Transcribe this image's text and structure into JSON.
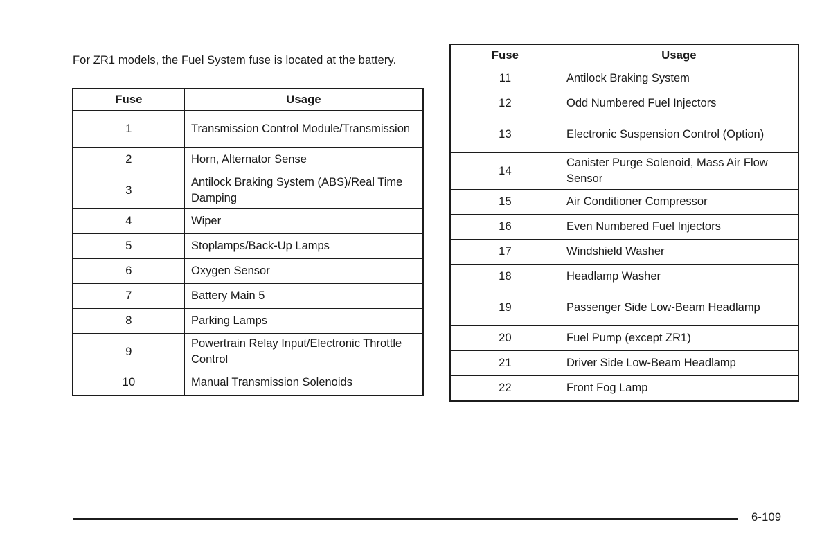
{
  "document": {
    "intro_text": "For ZR1 models, the Fuel System fuse is located at the battery.",
    "page_number": "6-109"
  },
  "tables": {
    "left": {
      "headers": {
        "fuse": "Fuse",
        "usage": "Usage"
      },
      "rows": [
        {
          "fuse": "1",
          "usage": "Transmission Control Module/Transmission",
          "lines": 2
        },
        {
          "fuse": "2",
          "usage": "Horn, Alternator Sense",
          "lines": 1
        },
        {
          "fuse": "3",
          "usage": "Antilock Braking System (ABS)/Real Time Damping",
          "lines": 2
        },
        {
          "fuse": "4",
          "usage": "Wiper",
          "lines": 1
        },
        {
          "fuse": "5",
          "usage": "Stoplamps/Back-Up Lamps",
          "lines": 1
        },
        {
          "fuse": "6",
          "usage": "Oxygen Sensor",
          "lines": 1
        },
        {
          "fuse": "7",
          "usage": "Battery Main 5",
          "lines": 1
        },
        {
          "fuse": "8",
          "usage": "Parking Lamps",
          "lines": 1
        },
        {
          "fuse": "9",
          "usage": "Powertrain Relay Input/Electronic Throttle Control",
          "lines": 2
        },
        {
          "fuse": "10",
          "usage": "Manual Transmission Solenoids",
          "lines": 1
        }
      ]
    },
    "right": {
      "headers": {
        "fuse": "Fuse",
        "usage": "Usage"
      },
      "rows": [
        {
          "fuse": "11",
          "usage": "Antilock Braking System",
          "lines": 1
        },
        {
          "fuse": "12",
          "usage": "Odd Numbered Fuel Injectors",
          "lines": 1
        },
        {
          "fuse": "13",
          "usage": "Electronic Suspension Control (Option)",
          "lines": 2
        },
        {
          "fuse": "14",
          "usage": "Canister Purge Solenoid, Mass Air Flow Sensor",
          "lines": 2
        },
        {
          "fuse": "15",
          "usage": "Air Conditioner Compressor",
          "lines": 1
        },
        {
          "fuse": "16",
          "usage": "Even Numbered Fuel Injectors",
          "lines": 1
        },
        {
          "fuse": "17",
          "usage": "Windshield Washer",
          "lines": 1
        },
        {
          "fuse": "18",
          "usage": "Headlamp Washer",
          "lines": 1
        },
        {
          "fuse": "19",
          "usage": "Passenger Side Low-Beam Headlamp",
          "lines": 2
        },
        {
          "fuse": "20",
          "usage": "Fuel Pump (except ZR1)",
          "lines": 1
        },
        {
          "fuse": "21",
          "usage": "Driver Side Low-Beam Headlamp",
          "lines": 1
        },
        {
          "fuse": "22",
          "usage": "Front Fog Lamp",
          "lines": 1
        }
      ]
    }
  }
}
